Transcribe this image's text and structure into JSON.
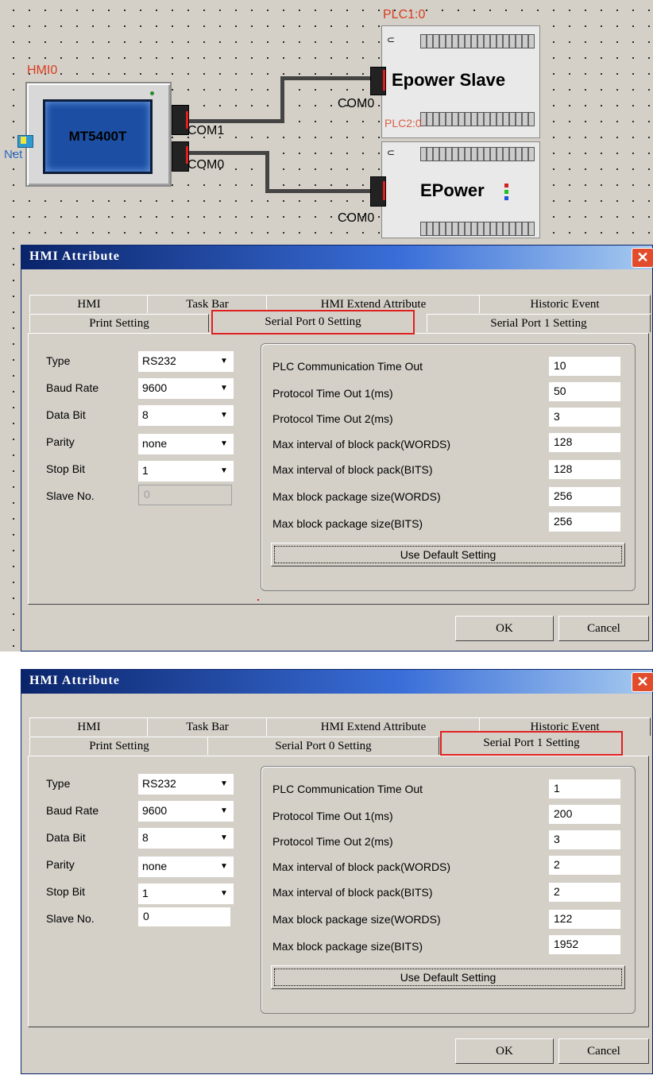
{
  "canvas": {
    "plc_top_label": "PLC1:0",
    "plc_bottom_label_overlap": "PLC2:0",
    "hmi_label": "HMI0",
    "hmi_model": "MT5400T",
    "net_label": "Net",
    "hmi_ports": [
      "COM1",
      "COM0"
    ],
    "plc_top_port": "COM0",
    "plc_bottom_port": "COM0",
    "plc_top_name": "Epower Slave",
    "plc_bottom_name": "EPower"
  },
  "dialogs": [
    {
      "title": "HMI Attribute",
      "close_label": "✕",
      "tabs_row1": [
        "HMI",
        "Task Bar",
        "HMI Extend Attribute",
        "Historic Event"
      ],
      "tabs_row2": [
        "Print Setting",
        "Serial Port 0 Setting",
        "Serial Port 1 Setting"
      ],
      "selected_tab": "Serial Port 0 Setting",
      "left_fields": [
        {
          "label": "Type",
          "value": "RS232"
        },
        {
          "label": "Baud Rate",
          "value": "9600"
        },
        {
          "label": "Data Bit",
          "value": "8"
        },
        {
          "label": "Parity",
          "value": "none"
        },
        {
          "label": "Stop Bit",
          "value": "1"
        },
        {
          "label": "Slave No.",
          "value": "0"
        }
      ],
      "right_fields": [
        {
          "label": "PLC Communication Time Out",
          "value": "10"
        },
        {
          "label": "Protocol Time Out 1(ms)",
          "value": "50"
        },
        {
          "label": "Protocol Time Out 2(ms)",
          "value": "3"
        },
        {
          "label": "Max interval of block pack(WORDS)",
          "value": "128"
        },
        {
          "label": "Max interval of block pack(BITS)",
          "value": "128"
        },
        {
          "label": "Max block package size(WORDS)",
          "value": "256"
        },
        {
          "label": "Max block package size(BITS)",
          "value": "256"
        }
      ],
      "default_button": "Use Default Setting",
      "ok": "OK",
      "cancel": "Cancel"
    },
    {
      "title": "HMI Attribute",
      "close_label": "✕",
      "tabs_row1": [
        "HMI",
        "Task Bar",
        "HMI Extend Attribute",
        "Historic Event"
      ],
      "tabs_row2": [
        "Print Setting",
        "Serial Port 0 Setting",
        "Serial Port 1 Setting"
      ],
      "selected_tab": "Serial Port 1 Setting",
      "left_fields": [
        {
          "label": "Type",
          "value": "RS232"
        },
        {
          "label": "Baud Rate",
          "value": "9600"
        },
        {
          "label": "Data Bit",
          "value": "8"
        },
        {
          "label": "Parity",
          "value": "none"
        },
        {
          "label": "Stop Bit",
          "value": "1"
        },
        {
          "label": "Slave No.",
          "value": "0"
        }
      ],
      "right_fields": [
        {
          "label": "PLC Communication Time Out",
          "value": "1"
        },
        {
          "label": "Protocol Time Out 1(ms)",
          "value": "200"
        },
        {
          "label": "Protocol Time Out 2(ms)",
          "value": "3"
        },
        {
          "label": "Max interval of block pack(WORDS)",
          "value": "2"
        },
        {
          "label": "Max interval of block pack(BITS)",
          "value": "2"
        },
        {
          "label": "Max block package size(WORDS)",
          "value": "122"
        },
        {
          "label": "Max block package size(BITS)",
          "value": "1952"
        }
      ],
      "default_button": "Use Default Setting",
      "ok": "OK",
      "cancel": "Cancel"
    }
  ],
  "colors": {
    "accent_red": "#e02020",
    "title_blue": "#0a246a",
    "dialog_gray": "#d4d0c8"
  }
}
